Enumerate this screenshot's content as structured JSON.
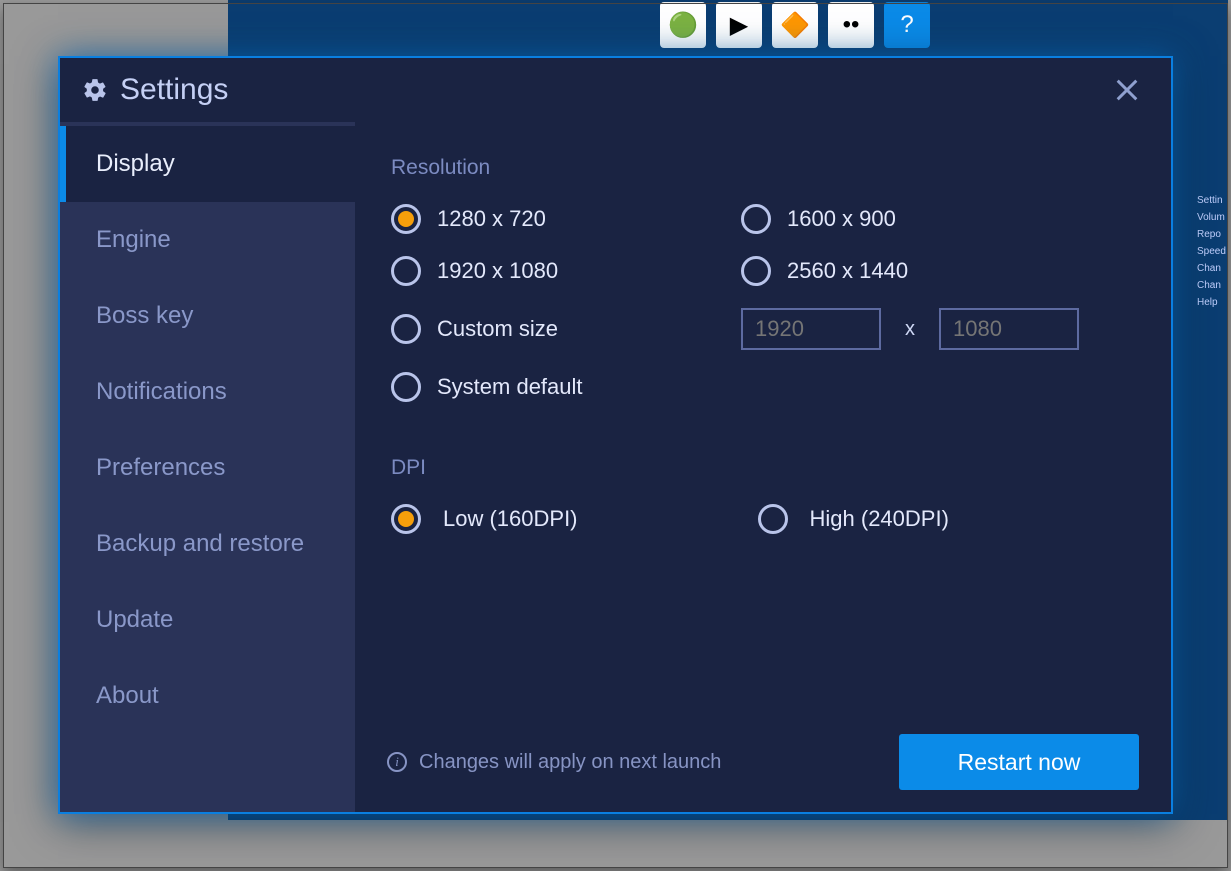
{
  "dialog": {
    "title": "Settings",
    "close_icon": "close-icon"
  },
  "sidebar": {
    "items": [
      {
        "label": "Display",
        "active": true
      },
      {
        "label": "Engine"
      },
      {
        "label": "Boss key"
      },
      {
        "label": "Notifications"
      },
      {
        "label": "Preferences"
      },
      {
        "label": "Backup and restore"
      },
      {
        "label": "Update"
      },
      {
        "label": "About"
      }
    ]
  },
  "resolution": {
    "title": "Resolution",
    "options": {
      "r0": "1280 x 720",
      "r1": "1600 x 900",
      "r2": "1920 x 1080",
      "r3": "2560 x 1440",
      "custom": "Custom size",
      "sys": "System default"
    },
    "selected": "r0",
    "custom_width": "1920",
    "custom_height": "1080",
    "x_sep": "x"
  },
  "dpi": {
    "title": "DPI",
    "options": {
      "low": "Low (160DPI)",
      "high": "High (240DPI)"
    },
    "selected": "low"
  },
  "footer": {
    "info": "Changes will apply on next launch",
    "restart": "Restart now"
  },
  "bg_menu": {
    "m0": "Settin",
    "m1": "Volum",
    "m2": "Repo",
    "m3": "Speed",
    "m4": "Chan",
    "m5": "Chan",
    "m6": "Help"
  }
}
